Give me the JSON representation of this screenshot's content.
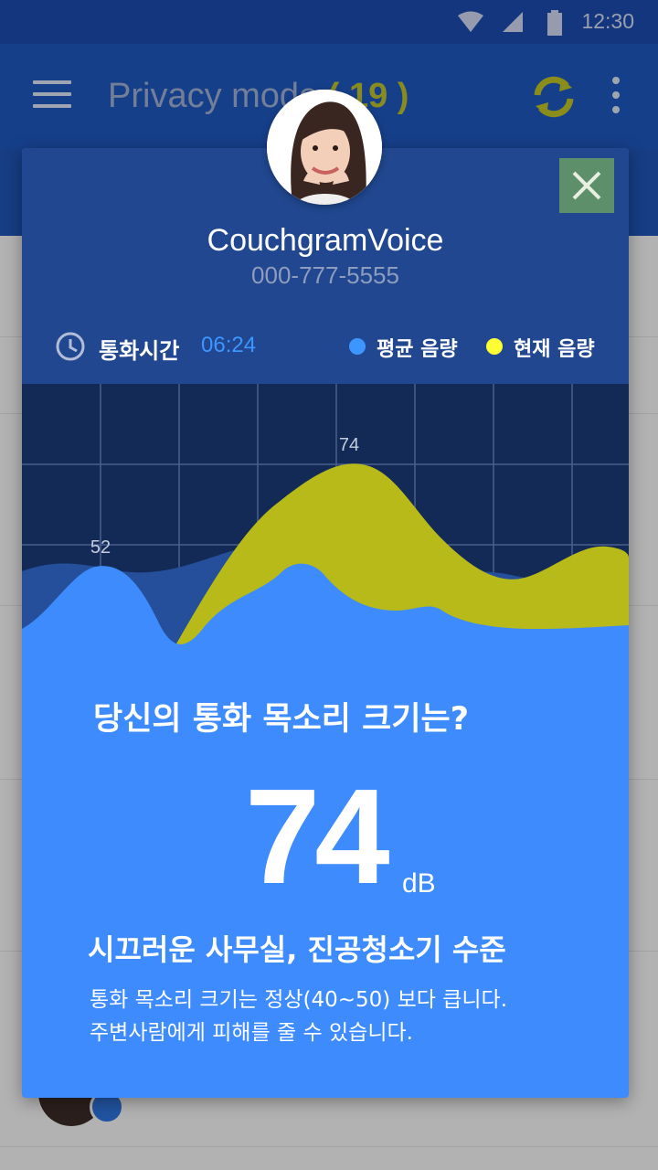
{
  "status_bar": {
    "time": "12:30"
  },
  "app_bar": {
    "title": "Privacy mode",
    "count": "( 19 )"
  },
  "dialog": {
    "caller_name": "CouchgramVoice",
    "caller_number": "000-777-5555",
    "call_time_label": "통화시간",
    "call_time_value": "06:24",
    "legend": [
      {
        "label": "평균 음량",
        "color": "#3d96ff"
      },
      {
        "label": "현재 음량",
        "color": "#ffff33"
      }
    ],
    "question": "당신의 통화 목소리 크기는?",
    "volume_value": "74",
    "volume_unit": "dB",
    "level_description": "시끄러운 사무실, 진공청소기 수준",
    "detail_lines": [
      "통화 목소리 크기는 정상(40~50) 보다 큽니다.",
      "주변사람에게 피해를 줄 수 있습니다."
    ]
  },
  "chart_data": {
    "type": "area",
    "series": [
      {
        "name": "평균 음량",
        "peak_label": "52",
        "color": "#3d8bfd"
      },
      {
        "name": "현재 음량",
        "peak_label": "74",
        "color": "#bfc21c"
      }
    ],
    "annotations": [
      "52",
      "74"
    ],
    "grid": true
  },
  "colors": {
    "primary": "#1e54b8",
    "dialog_header": "#20478f",
    "chart_bg": "#132a56",
    "average_fill": "#3d8bfd",
    "current_fill": "#bfc21c",
    "close_button": "#5c8f6a"
  }
}
